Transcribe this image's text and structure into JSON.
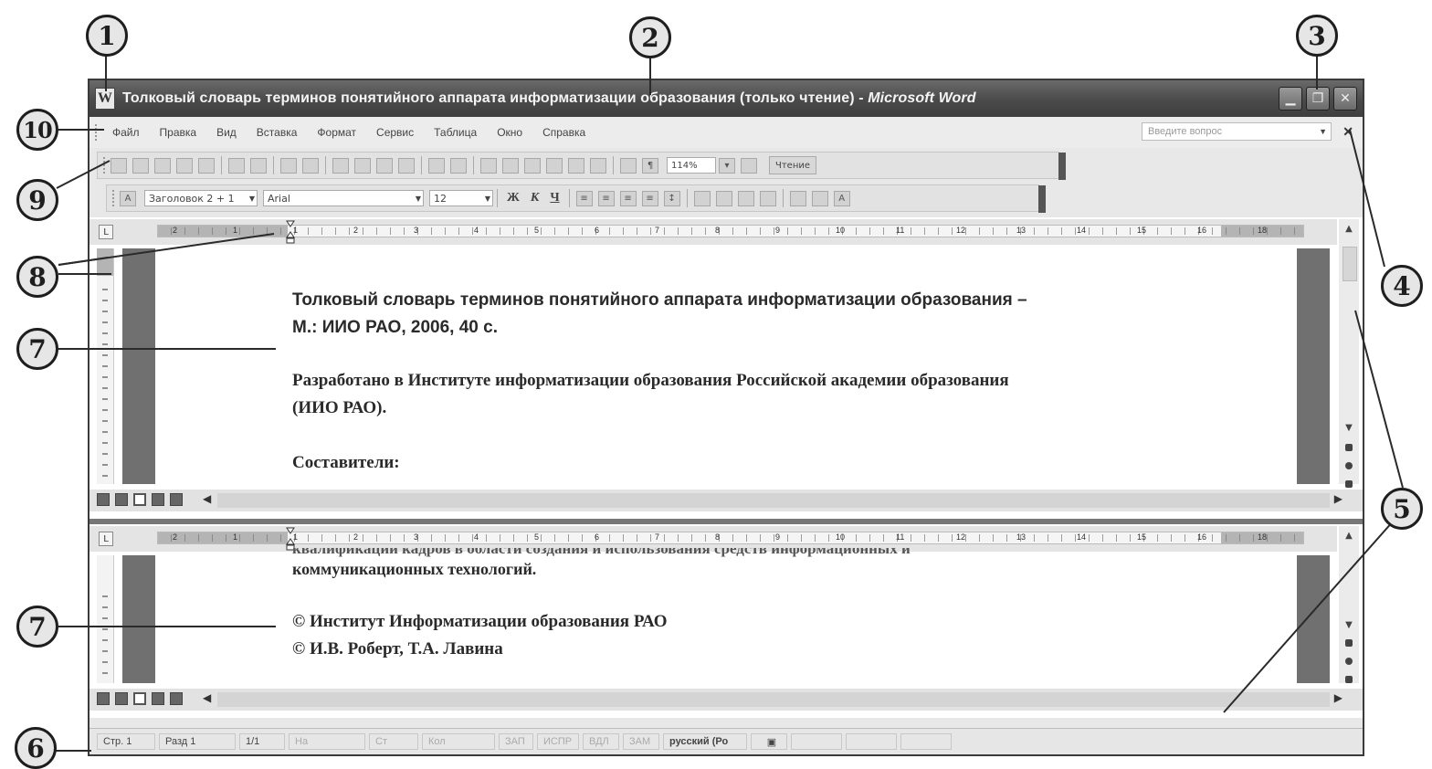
{
  "window": {
    "title": "Толковый словарь терминов понятийного аппарата информатизации образования (только чтение)",
    "app_name": "Microsoft Word",
    "controls": [
      "minimize",
      "maximize",
      "close"
    ]
  },
  "menu": {
    "items": [
      "Файл",
      "Правка",
      "Вид",
      "Вставка",
      "Формат",
      "Сервис",
      "Таблица",
      "Окно",
      "Справка"
    ],
    "ask_placeholder": "Введите вопрос"
  },
  "standard_toolbar": {
    "zoom": "114%",
    "reading_label": "Чтение"
  },
  "formatting_toolbar": {
    "style": "Заголовок 2 + 1",
    "font": "Arial",
    "size": "12",
    "bold": "Ж",
    "italic": "К",
    "underline": "Ч"
  },
  "ruler": {
    "marks": [
      "2",
      "1",
      "1",
      "2",
      "3",
      "4",
      "5",
      "6",
      "7",
      "8",
      "9",
      "10",
      "11",
      "12",
      "13",
      "14",
      "15",
      "16",
      "18"
    ]
  },
  "top_pane": {
    "heading": "Толковый словарь терминов понятийного аппарата информатизации образования –",
    "heading_line2": "М.: ИИО РАО, 2006, 40 с.",
    "para1": "Разработано в Институте информатизации образования Российской академии образования",
    "para1_line2": "(ИИО РАО).",
    "para2": "Составители:"
  },
  "bottom_pane": {
    "line0": "квалификации кадров в области создания и использования средств информационных и",
    "line1": "коммуникационных технологий.",
    "line2": "© Институт Информатизации образования РАО",
    "line3": "© И.В. Роберт, Т.А. Лавина"
  },
  "statusbar": {
    "page": "Стр. 1",
    "section": "Разд 1",
    "pages": "1/1",
    "at": "На",
    "line": "Ст",
    "col": "Кол",
    "rec": "ЗАП",
    "trk": "ИСПР",
    "ext": "ВДЛ",
    "ovr": "ЗАМ",
    "language": "русский (Ро"
  },
  "callouts": [
    "1",
    "2",
    "3",
    "4",
    "5",
    "6",
    "7",
    "7",
    "8",
    "9",
    "10"
  ]
}
